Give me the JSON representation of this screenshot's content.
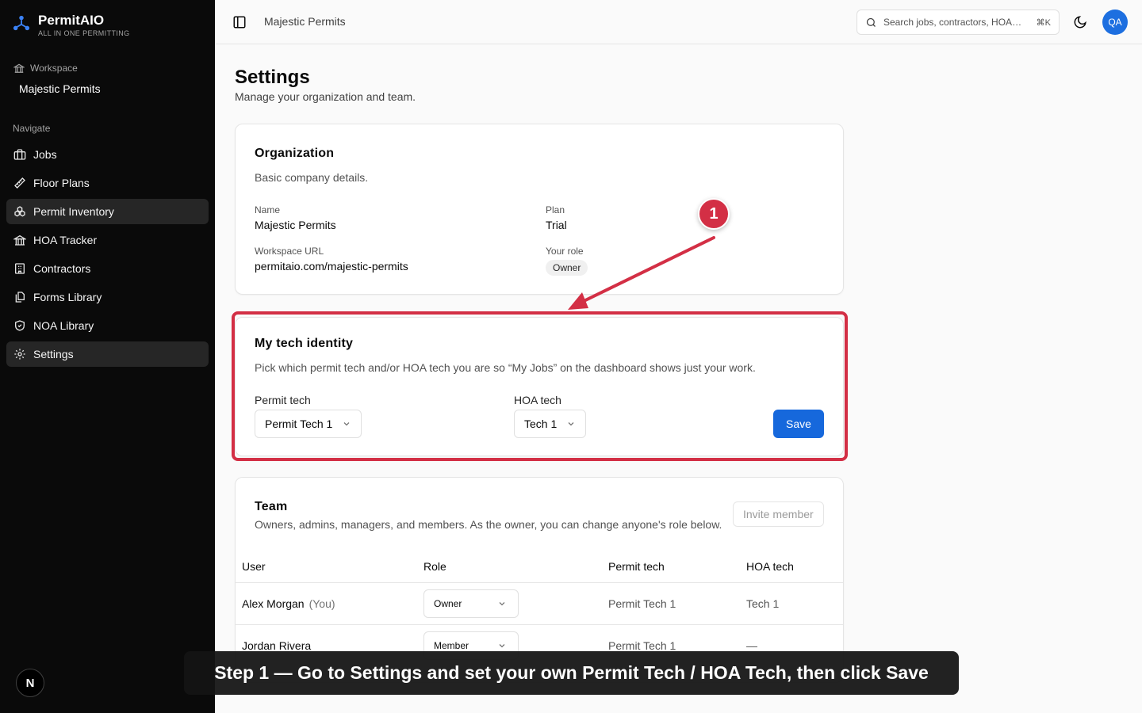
{
  "brand": {
    "name": "PermitAIO",
    "tagline": "ALL IN ONE PERMITTING"
  },
  "workspace": {
    "label": "Workspace",
    "name": "Majestic Permits"
  },
  "nav": {
    "label": "Navigate",
    "items": [
      {
        "label": "Jobs",
        "icon": "briefcase-icon"
      },
      {
        "label": "Floor Plans",
        "icon": "ruler-icon"
      },
      {
        "label": "Permit Inventory",
        "icon": "boxes-icon"
      },
      {
        "label": "HOA Tracker",
        "icon": "landmark-icon"
      },
      {
        "label": "Contractors",
        "icon": "building-icon"
      },
      {
        "label": "Forms Library",
        "icon": "files-icon"
      },
      {
        "label": "NOA Library",
        "icon": "shield-check-icon"
      },
      {
        "label": "Settings",
        "icon": "gear-icon"
      }
    ],
    "active": [
      "Permit Inventory",
      "Settings"
    ]
  },
  "topbar": {
    "breadcrumb": "Majestic Permits",
    "search_placeholder": "Search jobs, contractors, HOA…",
    "search_shortcut": "⌘K",
    "avatar_initials": "QA"
  },
  "page": {
    "title": "Settings",
    "subtitle": "Manage your organization and team."
  },
  "organization": {
    "title": "Organization",
    "description": "Basic company details.",
    "name_label": "Name",
    "name_value": "Majestic Permits",
    "plan_label": "Plan",
    "plan_value": "Trial",
    "url_label": "Workspace URL",
    "url_value": "permitaio.com/majestic-permits",
    "role_label": "Your role",
    "role_value": "Owner"
  },
  "identity": {
    "title": "My tech identity",
    "description": "Pick which permit tech and/or HOA tech you are so “My Jobs” on the dashboard shows just your work.",
    "permit_label": "Permit tech",
    "permit_value": "Permit Tech 1",
    "hoa_label": "HOA tech",
    "hoa_value": "Tech 1",
    "save_label": "Save"
  },
  "team": {
    "title": "Team",
    "description": "Owners, admins, managers, and members. As the owner, you can change anyone's role below.",
    "invite_label": "Invite member",
    "columns": [
      "User",
      "Role",
      "Permit tech",
      "HOA tech"
    ],
    "rows": [
      {
        "user": "Alex Morgan",
        "you": "(You)",
        "role": "Owner",
        "permit": "Permit Tech 1",
        "hoa": "Tech 1"
      },
      {
        "user": "Jordan Rivera",
        "you": "",
        "role": "Member",
        "permit": "Permit Tech 1",
        "hoa": "—"
      }
    ]
  },
  "annotation": {
    "step_number": "1",
    "caption": "Step 1 — Go to Settings and set your own Permit Tech / HOA Tech, then click Save",
    "color": "#d32f45"
  },
  "footer_badge": "N"
}
